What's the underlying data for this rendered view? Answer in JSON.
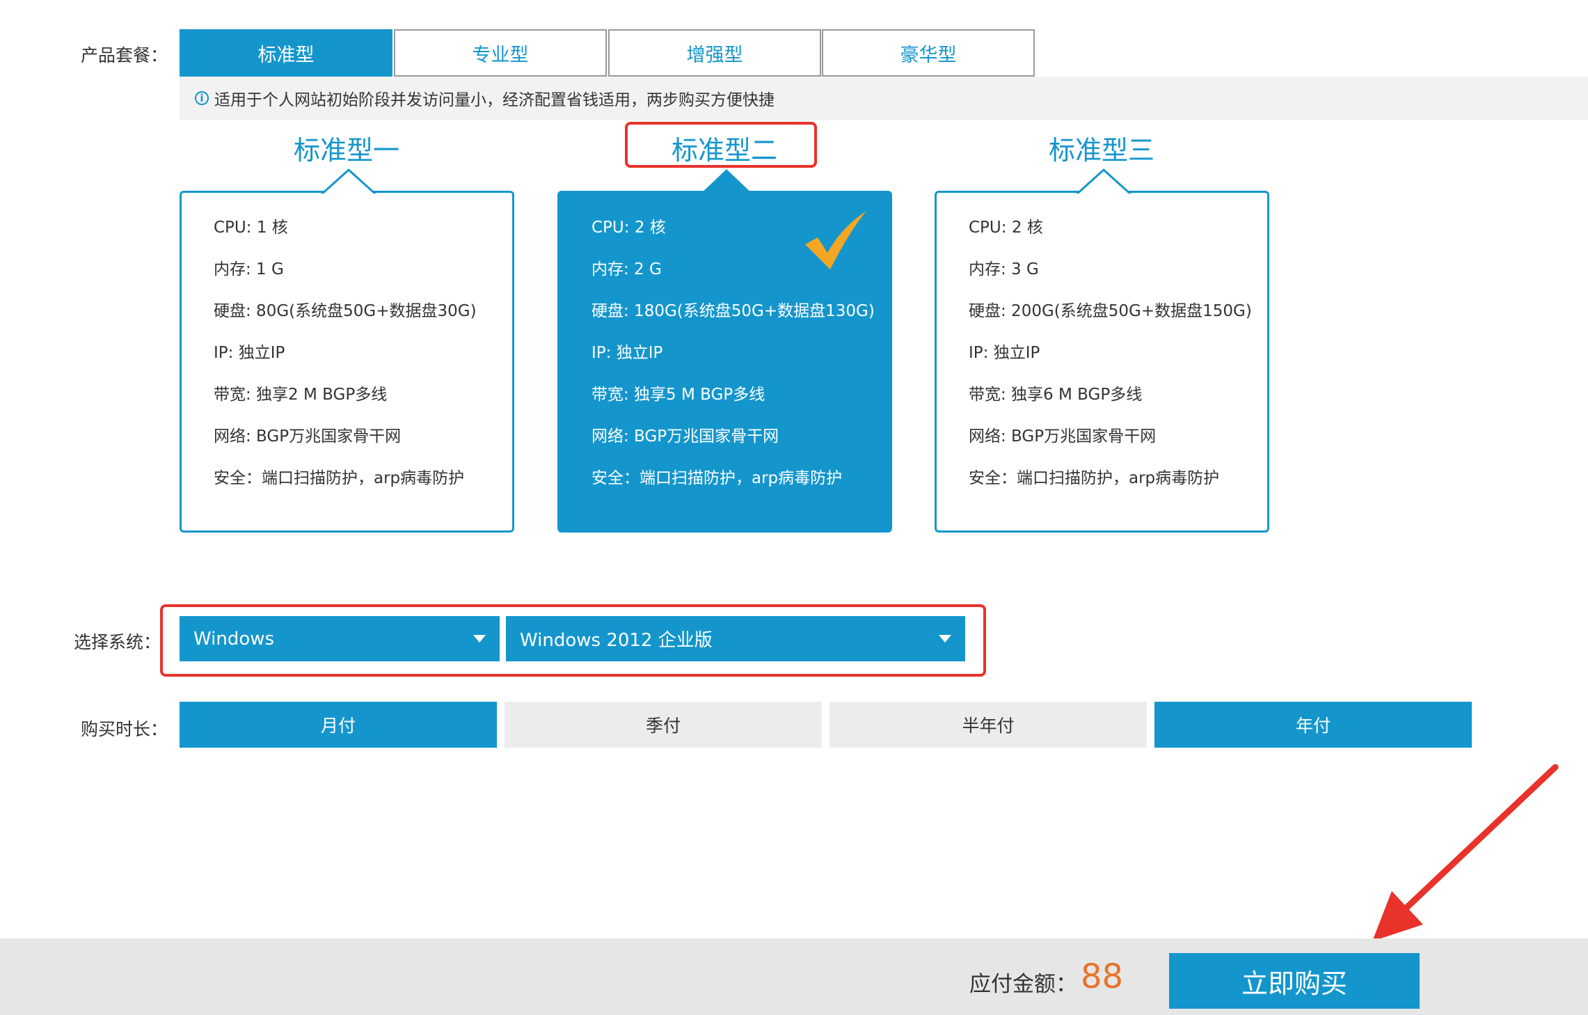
{
  "package_row": {
    "label": "产品套餐：",
    "tabs": [
      "标准型",
      "专业型",
      "增强型",
      "豪华型"
    ],
    "active_index": 0,
    "info": "适用于个人网站初始阶段并发访问量小，经济配置省钱适用，两步购买方便快捷"
  },
  "plans": [
    {
      "title": "标准型一",
      "lines": [
        "CPU: 1 核",
        "内存: 1 G",
        "硬盘: 80G(系统盘50G+数据盘30G)",
        "IP: 独立IP",
        "带宽: 独享2 M BGP多线",
        "网络: BGP万兆国家骨干网",
        "安全：端口扫描防护，arp病毒防护"
      ]
    },
    {
      "title": "标准型二",
      "selected": true,
      "lines": [
        "CPU: 2 核",
        "内存: 2 G",
        "硬盘: 180G(系统盘50G+数据盘130G)",
        "IP: 独立IP",
        "带宽: 独享5 M BGP多线",
        "网络: BGP万兆国家骨干网",
        "安全：端口扫描防护，arp病毒防护"
      ]
    },
    {
      "title": "标准型三",
      "lines": [
        "CPU: 2 核",
        "内存: 3 G",
        "硬盘: 200G(系统盘50G+数据盘150G)",
        "IP: 独立IP",
        "带宽: 独享6 M BGP多线",
        "网络: BGP万兆国家骨干网",
        "安全：端口扫描防护，arp病毒防护"
      ]
    }
  ],
  "os_row": {
    "label": "选择系统：",
    "os_family": "Windows",
    "os_version": "Windows 2012 企业版"
  },
  "duration_row": {
    "label": "购买时长：",
    "options": [
      "月付",
      "季付",
      "半年付",
      "年付"
    ]
  },
  "footer": {
    "amount_label": "应付金额：",
    "amount": "88",
    "buy_label": "立即购买"
  },
  "colors": {
    "accent": "#1496cd",
    "highlight": "#e8322a",
    "price": "#e8732a",
    "check": "#f5a623"
  },
  "icons": [
    "info-icon",
    "checkmark-icon",
    "chevron-down-icon",
    "arrow-annotation-icon"
  ]
}
